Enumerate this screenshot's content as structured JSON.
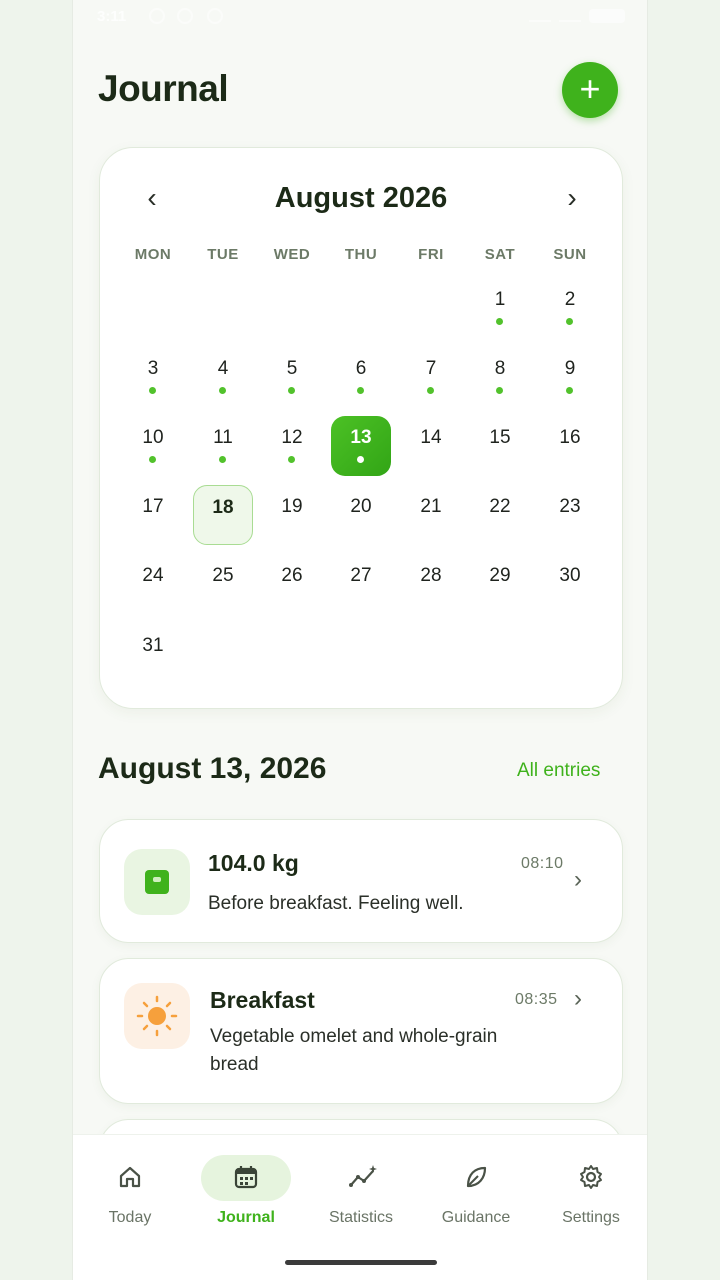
{
  "status_bar": {
    "time": "3:11"
  },
  "header": {
    "title": "Journal",
    "add_label": "+"
  },
  "calendar": {
    "month_label": "August 2026",
    "prev": "‹",
    "next": "›",
    "weekdays": [
      "MON",
      "TUE",
      "WED",
      "THU",
      "FRI",
      "SAT",
      "SUN"
    ],
    "selected_day": 13,
    "today_day": 18,
    "days_with_entries": [
      1,
      2,
      3,
      4,
      5,
      6,
      7,
      8,
      9,
      10,
      11,
      12,
      13
    ],
    "days": [
      "1",
      "2",
      "3",
      "4",
      "5",
      "6",
      "7",
      "8",
      "9",
      "10",
      "11",
      "12",
      "13",
      "14",
      "15",
      "16",
      "17",
      "18",
      "19",
      "20",
      "21",
      "22",
      "23",
      "24",
      "25",
      "26",
      "27",
      "28",
      "29",
      "30",
      "31"
    ]
  },
  "day_section": {
    "heading": "August 13, 2026",
    "all_entries": "All entries"
  },
  "entries": [
    {
      "title": "104.0 kg",
      "time": "08:10",
      "description": "Before breakfast. Feeling well.",
      "icon": "scale-icon"
    },
    {
      "title": "Breakfast",
      "time": "08:35",
      "description": "Vegetable omelet and whole-grain bread",
      "icon": "sun-icon"
    }
  ],
  "nav": [
    {
      "label": "Today",
      "icon": "home-icon"
    },
    {
      "label": "Journal",
      "icon": "calendar-icon"
    },
    {
      "label": "Statistics",
      "icon": "chart-icon"
    },
    {
      "label": "Guidance",
      "icon": "leaf-icon"
    },
    {
      "label": "Settings",
      "icon": "gear-icon"
    }
  ],
  "colors": {
    "accent": "#3fb21c",
    "dot": "#52c22c",
    "background": "#f7f9f5"
  }
}
